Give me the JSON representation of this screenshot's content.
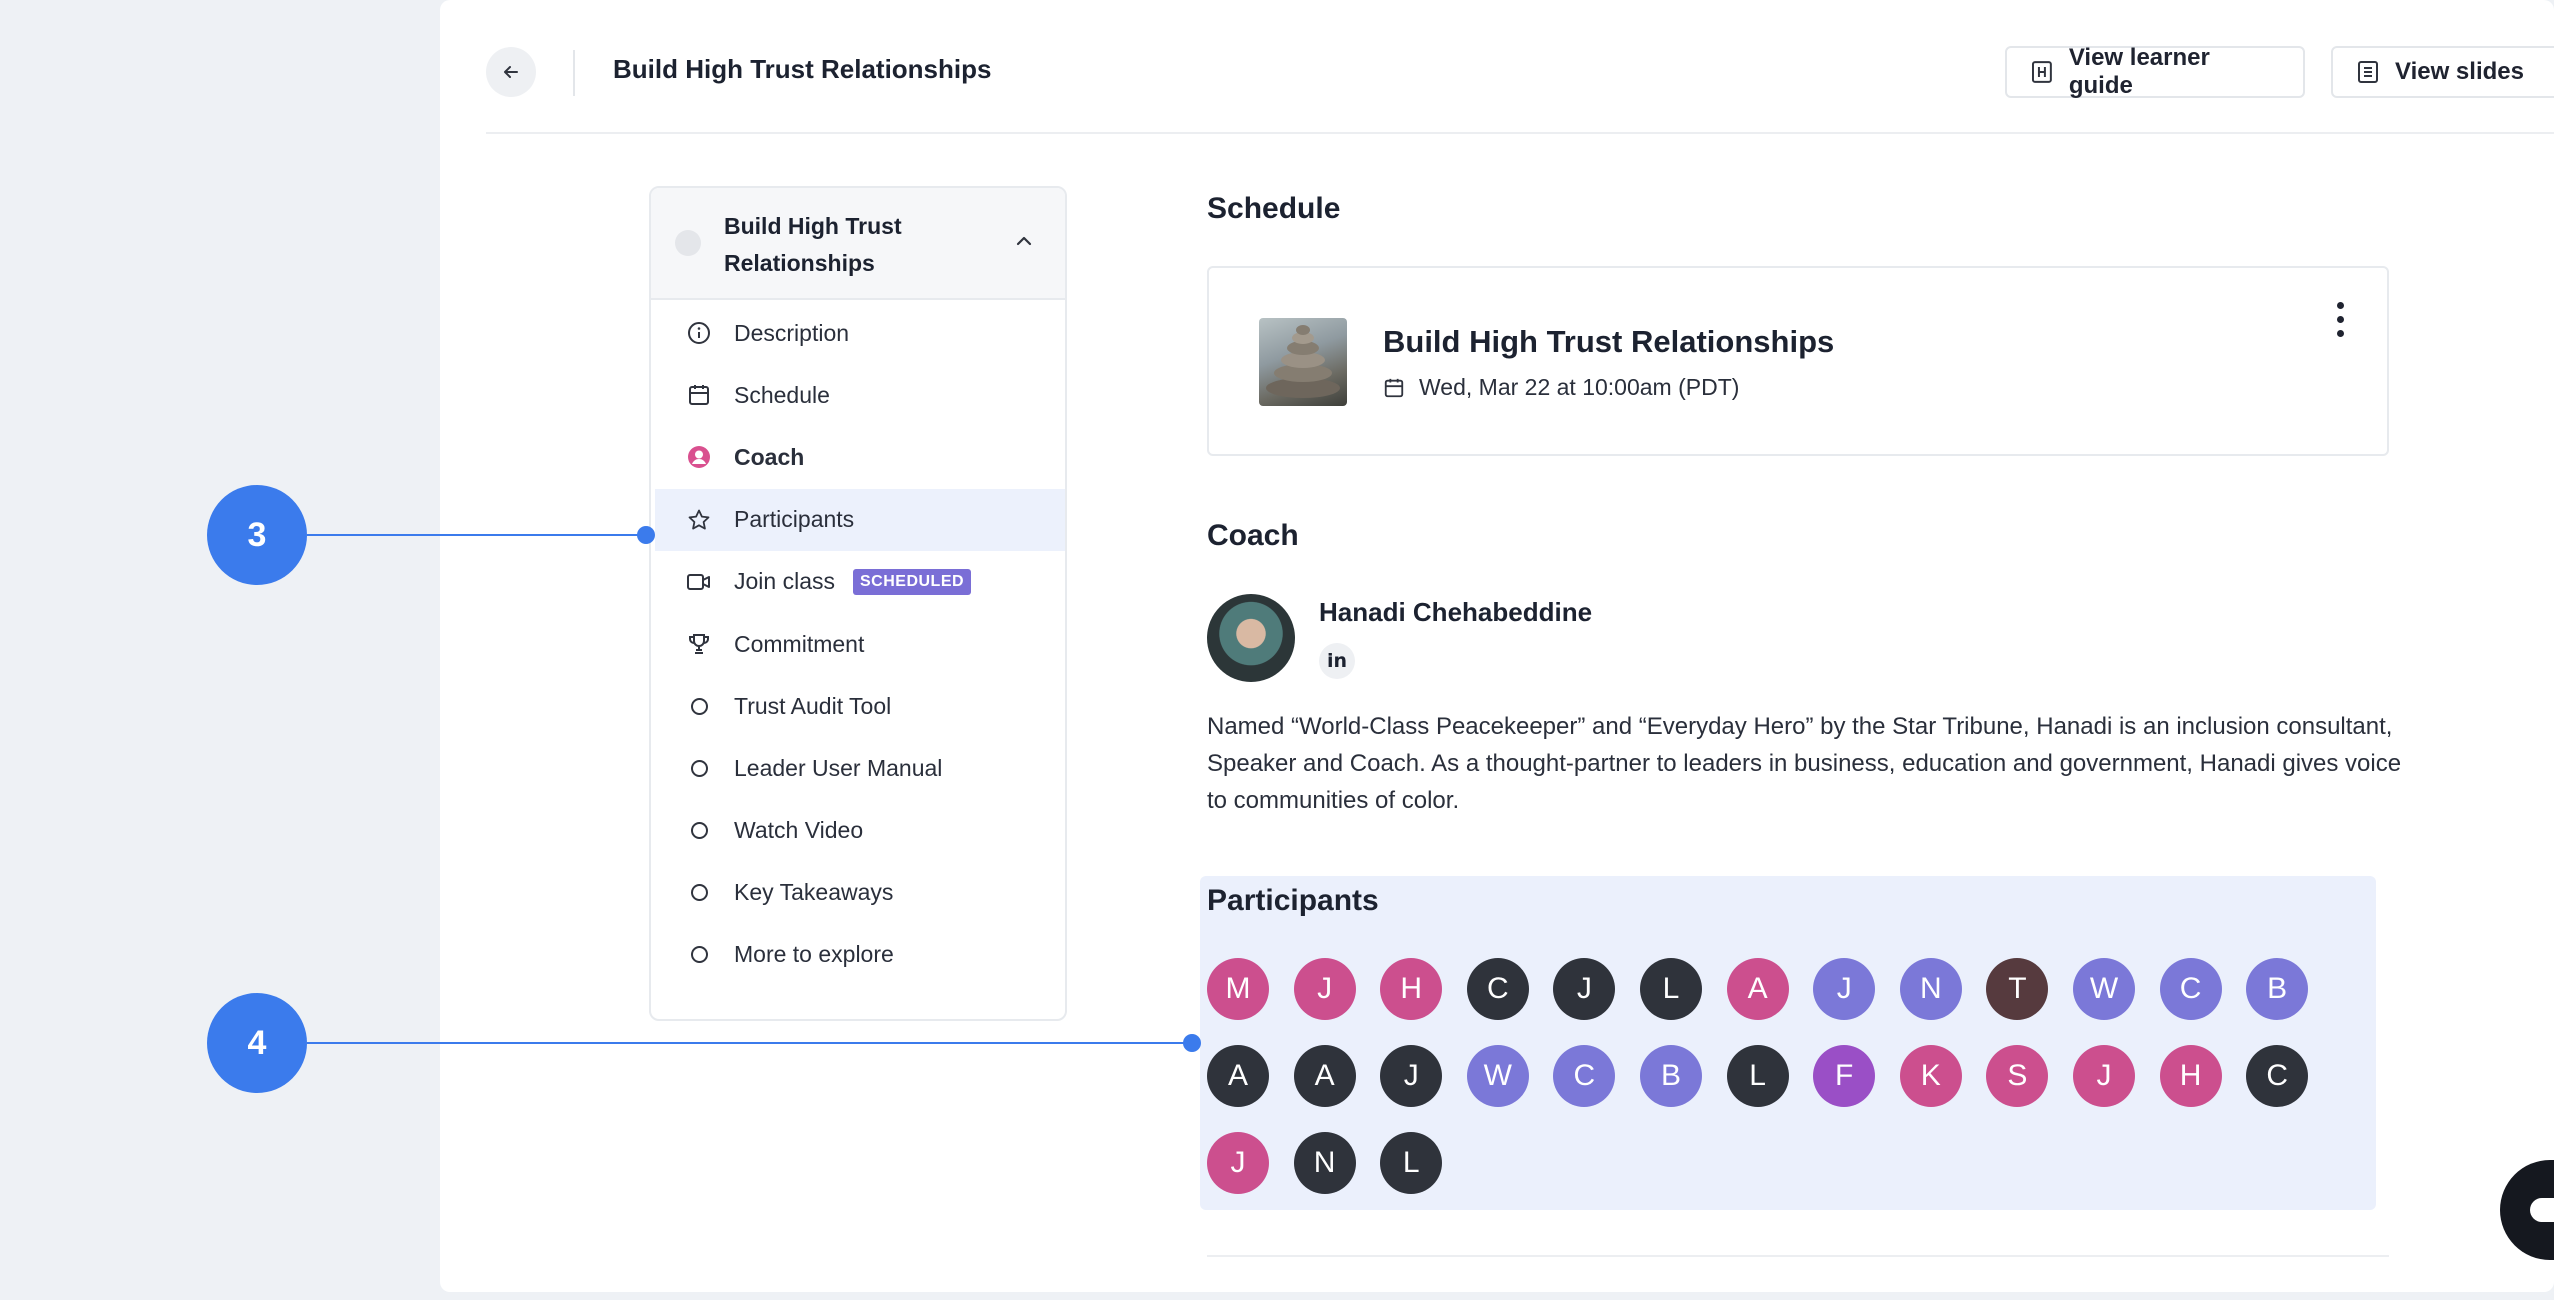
{
  "header": {
    "title": "Build High Trust Relationships",
    "learner_guide_label": "View learner guide",
    "slides_label": "View slides"
  },
  "sidebar": {
    "title": "Build High Trust Relationships",
    "items": [
      {
        "label": "Description",
        "icon": "info-icon"
      },
      {
        "label": "Schedule",
        "icon": "calendar-icon"
      },
      {
        "label": "Coach",
        "icon": "user-icon"
      },
      {
        "label": "Participants",
        "icon": "star-icon"
      },
      {
        "label": "Join class",
        "icon": "video-icon",
        "badge": "SCHEDULED"
      },
      {
        "label": "Commitment",
        "icon": "trophy-icon"
      },
      {
        "label": "Trust Audit Tool",
        "icon": "circle-icon"
      },
      {
        "label": "Leader User Manual",
        "icon": "circle-icon"
      },
      {
        "label": "Watch Video",
        "icon": "circle-icon"
      },
      {
        "label": "Key Takeaways",
        "icon": "circle-icon"
      },
      {
        "label": "More to explore",
        "icon": "circle-icon"
      }
    ]
  },
  "schedule": {
    "section_title": "Schedule",
    "event_title": "Build High Trust Relationships",
    "event_date": "Wed, Mar 22 at 10:00am (PDT)"
  },
  "coach": {
    "section_title": "Coach",
    "name": "Hanadi Chehabeddine",
    "linkedin_label": "in",
    "bio": "Named “World-Class Peacekeeper” and “Everyday Hero” by the Star Tribune, Hanadi is an inclusion consultant, Speaker and Coach. As a thought-partner to leaders in business, education and government, Hanadi gives voice to communities of color."
  },
  "participants": {
    "section_title": "Participants",
    "people": [
      {
        "initial": "M",
        "color": "#cc4f8e"
      },
      {
        "initial": "J",
        "color": "#cc4f8e"
      },
      {
        "initial": "H",
        "color": "#cc4f8e"
      },
      {
        "initial": "C",
        "color": "#2f333b"
      },
      {
        "initial": "J",
        "color": "#2f333b"
      },
      {
        "initial": "L",
        "color": "#2f333b"
      },
      {
        "initial": "A",
        "color": "#cc4f8e"
      },
      {
        "initial": "J",
        "color": "#7b78d8"
      },
      {
        "initial": "N",
        "color": "#7b78d8"
      },
      {
        "initial": "T",
        "color": "#563a3e"
      },
      {
        "initial": "W",
        "color": "#7b78d8"
      },
      {
        "initial": "C",
        "color": "#7b78d8"
      },
      {
        "initial": "B",
        "color": "#7b78d8"
      },
      {
        "initial": "A",
        "color": "#2f333b"
      },
      {
        "initial": "A",
        "color": "#2f333b"
      },
      {
        "initial": "J",
        "color": "#2f333b"
      },
      {
        "initial": "W",
        "color": "#7b78d8"
      },
      {
        "initial": "C",
        "color": "#7b78d8"
      },
      {
        "initial": "B",
        "color": "#7b78d8"
      },
      {
        "initial": "L",
        "color": "#2f333b"
      },
      {
        "initial": "F",
        "color": "#9a4fc6"
      },
      {
        "initial": "K",
        "color": "#cc4f8e"
      },
      {
        "initial": "S",
        "color": "#cc4f8e"
      },
      {
        "initial": "J",
        "color": "#cc4f8e"
      },
      {
        "initial": "H",
        "color": "#cc4f8e"
      },
      {
        "initial": "C",
        "color": "#2f333b"
      },
      {
        "initial": "J",
        "color": "#cc4f8e"
      },
      {
        "initial": "N",
        "color": "#2f333b"
      },
      {
        "initial": "L",
        "color": "#2f333b"
      }
    ]
  },
  "callouts": {
    "first": "3",
    "second": "4"
  },
  "colors": {
    "accent": "#3b7bec",
    "badge": "#7a6ed6",
    "active_item_bg": "#ecf1fc",
    "participants_bg": "#ebf0fc"
  }
}
